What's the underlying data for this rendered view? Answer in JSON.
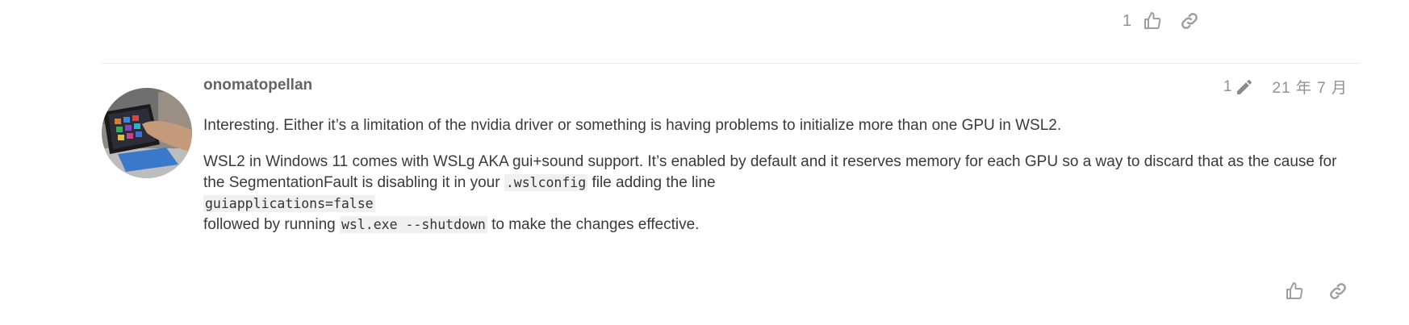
{
  "previous_post": {
    "like_count": "1",
    "like_icon": "thumbs-up-icon",
    "share_icon": "link-icon"
  },
  "post": {
    "author": "onomatopellan",
    "avatar": "avatar-photo-tablet",
    "edit_count": "1",
    "edit_icon": "pencil-icon",
    "date": "21 年 7 月",
    "paragraph1": "Interesting. Either it’s a limitation of the nvidia driver or something is having problems to initialize more than one GPU in WSL2.",
    "paragraph2_part1": "WSL2 in Windows 11 comes with WSLg AKA gui+sound support. It’s enabled by default and it reserves memory for each GPU so a way to discard that as the cause for the SegmentationFault is disabling it in your ",
    "paragraph2_code1": ".wslconfig",
    "paragraph2_part2": " file adding the line",
    "paragraph2_code2": "guiapplications=false",
    "paragraph2_part3": "followed by running ",
    "paragraph2_code3": "wsl.exe --shutdown",
    "paragraph2_part4": " to make the changes effective.",
    "like_icon": "thumbs-up-icon",
    "share_icon": "link-icon"
  },
  "colors": {
    "icon_gray": "#9e9e9e",
    "author": "#646464",
    "code_bg": "#f0f0f0",
    "divider": "#e9e9e9"
  }
}
